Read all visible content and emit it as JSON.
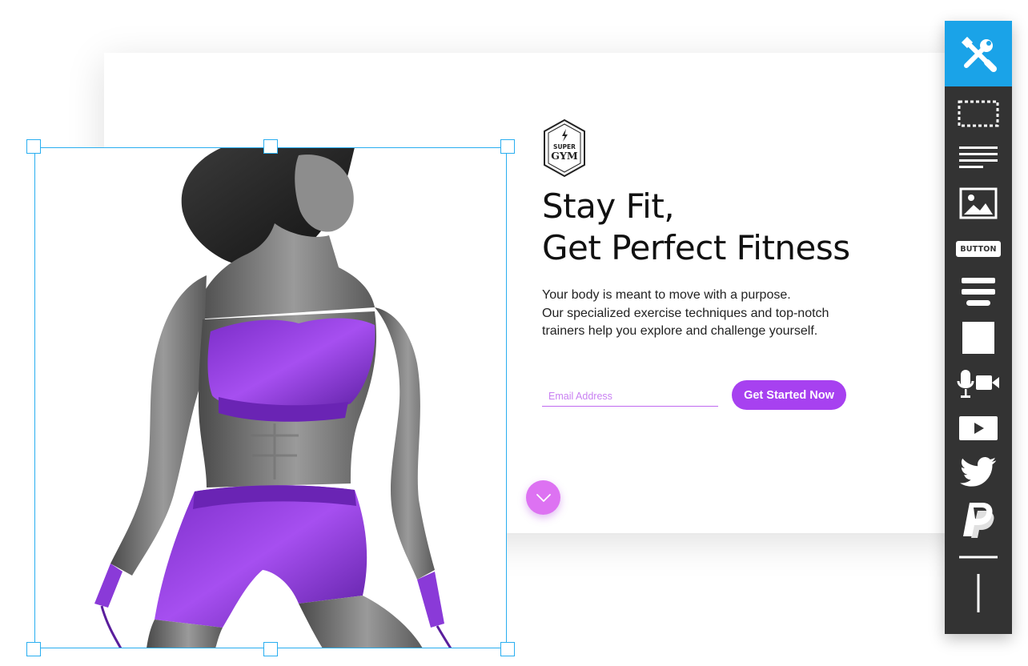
{
  "logo": {
    "line1": "SUPER",
    "line2": "GYM"
  },
  "hero": {
    "headline_line1": "Stay Fit,",
    "headline_line2": "Get Perfect Fitness",
    "body_line1": "Your body is meant to move with a purpose.",
    "body_line2": "Our specialized exercise techniques and top-notch",
    "body_line3": "trainers help you explore and challenge yourself."
  },
  "form": {
    "email_placeholder": "Email Address",
    "cta_label": "Get Started Now"
  },
  "toolbar": {
    "tools": [
      {
        "icon": "tools-icon"
      },
      {
        "icon": "box-select-icon"
      },
      {
        "icon": "text-icon"
      },
      {
        "icon": "image-icon"
      },
      {
        "icon": "button-icon",
        "label": "BUTTON"
      },
      {
        "icon": "menu-icon"
      },
      {
        "icon": "shape-icon"
      },
      {
        "icon": "media-icon"
      },
      {
        "icon": "video-icon"
      },
      {
        "icon": "twitter-icon"
      },
      {
        "icon": "paypal-icon"
      },
      {
        "icon": "horizontal-line-icon"
      },
      {
        "icon": "vertical-line-icon"
      }
    ]
  },
  "colors": {
    "accent": "#a741f0",
    "accent_light": "#dd72f2",
    "selection": "#29aef0",
    "toolbar": "#333333",
    "toolbar_active": "#1aa3e8"
  }
}
